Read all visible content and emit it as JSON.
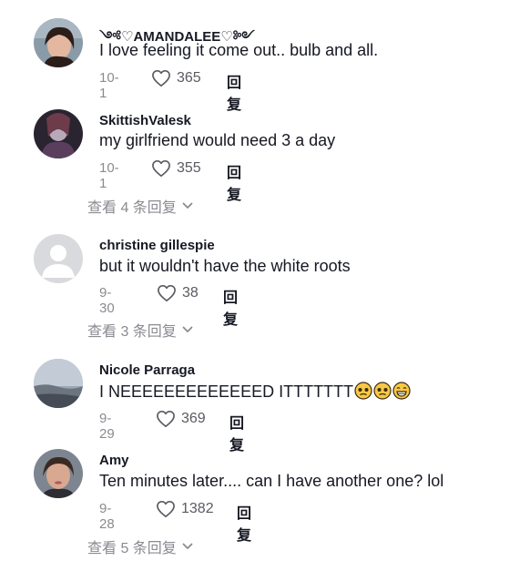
{
  "comments": [
    {
      "name": "༺♡AMANDALEE♡༻",
      "text": "I love feeling it come out.. bulb and all.",
      "date": "10-1",
      "likes": "365",
      "reply": "回复"
    },
    {
      "name": "SkittishValesk",
      "text": "my girlfriend would need 3 a day",
      "date": "10-1",
      "likes": "355",
      "reply": "回复",
      "view_replies": "查看 4 条回复"
    },
    {
      "name": "christine gillespie",
      "text": "but it wouldn't have the white roots",
      "date": "9-30",
      "likes": "38",
      "reply": "回复",
      "view_replies": "查看 3 条回复"
    },
    {
      "name": "Nicole Parraga",
      "text": "I NEEEEEEEEEEEEED ITTTTTTT",
      "emojis": [
        "pleading-face",
        "pleading-face",
        "grinning-face"
      ],
      "date": "9-29",
      "likes": "369",
      "reply": "回复"
    },
    {
      "name": "Amy",
      "text": "Ten minutes later.... can I have another one? lol",
      "date": "9-28",
      "likes": "1382",
      "reply": "回复",
      "view_replies": "查看 5 条回复"
    }
  ],
  "icons": {
    "like": "heart-outline-icon",
    "expand": "chevron-down-icon"
  },
  "colors": {
    "text": "#161823",
    "muted": "#8a8b91"
  }
}
